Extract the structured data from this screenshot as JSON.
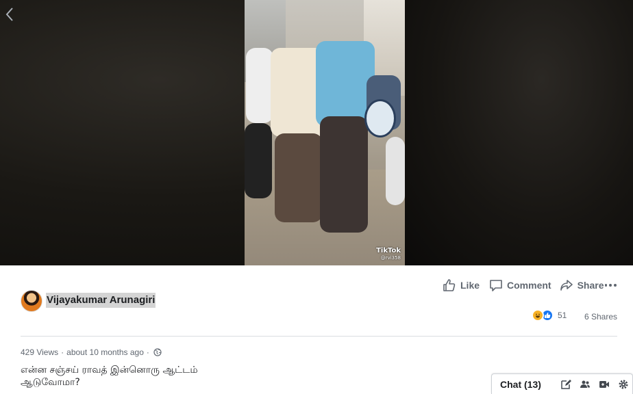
{
  "video": {
    "watermark_brand": "TikTok",
    "watermark_handle": "@rvi358"
  },
  "post": {
    "author_name": "Vijayakumar Arunagiri",
    "actions": {
      "like": "Like",
      "comment": "Comment",
      "share": "Share"
    },
    "reactions": {
      "count": "51",
      "types": [
        "haha-icon",
        "like-icon"
      ]
    },
    "shares_text": "6 Shares",
    "views_text": "429 Views",
    "separator": "·",
    "time_text": "about 10 months ago",
    "caption_line1": "என்ன சஞ்சய் ராவத் இன்னொரு ஆட்டம்",
    "caption_line2": "ஆடுவோமா?"
  },
  "chat": {
    "label": "Chat (13)"
  },
  "colors": {
    "accent": "#1877f2",
    "text_secondary": "#606770",
    "haha": "#f7b125"
  }
}
